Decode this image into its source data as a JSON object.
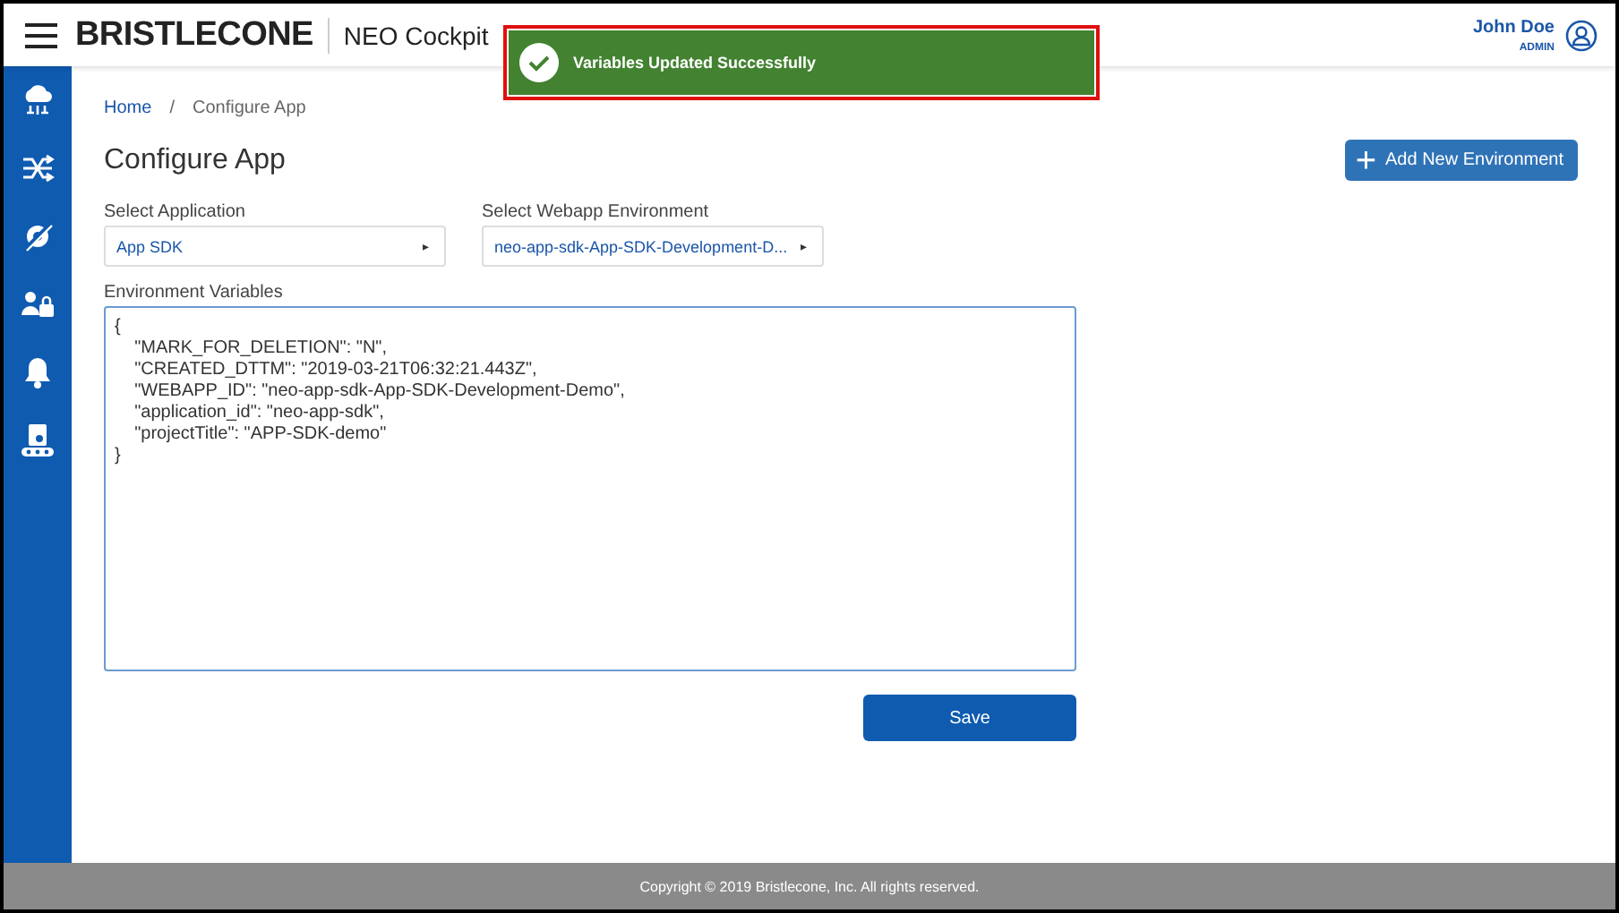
{
  "header": {
    "brand": "BRISTLECONE",
    "app_name": "NEO Cockpit",
    "user": {
      "name": "John Doe",
      "role": "ADMIN"
    }
  },
  "toast": {
    "message": "Variables Updated Successfully"
  },
  "sidebar": {
    "items": [
      {
        "kind": "cloud"
      },
      {
        "kind": "shuffle"
      },
      {
        "kind": "tools"
      },
      {
        "kind": "users"
      },
      {
        "kind": "bell"
      },
      {
        "kind": "conveyor"
      }
    ]
  },
  "breadcrumb": [
    {
      "label": "Home",
      "link": true
    },
    {
      "label": "/",
      "link": false
    },
    {
      "label": "Configure App",
      "link": false
    }
  ],
  "page_title": "Configure App",
  "add_button": {
    "icon": "+",
    "label": "Add New Environment"
  },
  "selects": [
    {
      "label": "Select Application",
      "value": "App SDK",
      "arrow": "▸"
    },
    {
      "label": "Select Webapp Environment",
      "value": "neo-app-sdk-App-SDK-Development-D...",
      "arrow": "▸"
    }
  ],
  "env": {
    "label": "Environment Variables",
    "value": "{\n    \"MARK_FOR_DELETION\": \"N\",\n    \"CREATED_DTTM\": \"2019-03-21T06:32:21.443Z\",\n    \"WEBAPP_ID\": \"neo-app-sdk-App-SDK-Development-Demo\",\n    \"application_id\": \"neo-app-sdk\",\n    \"projectTitle\": \"APP-SDK-demo\"\n}"
  },
  "save_button": "Save",
  "footer": "Copyright © 2019 Bristlecone, Inc. All rights reserved."
}
